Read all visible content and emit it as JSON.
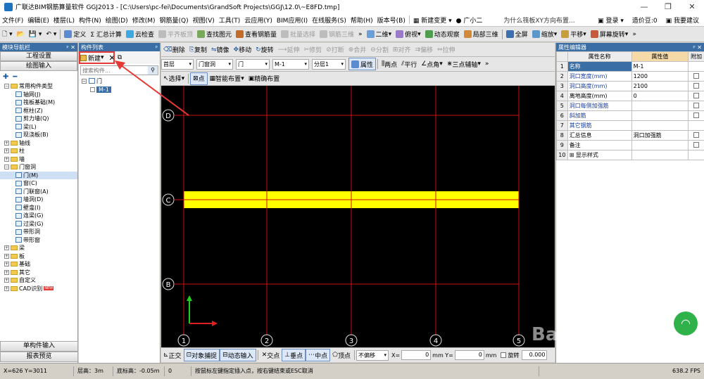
{
  "app": {
    "title": "广联达BIM钢筋算量软件 GGJ2013 - [C:\\Users\\pc-fei\\Documents\\GrandSoft Projects\\GGJ\\12.0\\~E8FD.tmp]",
    "window_controls": [
      "—",
      "❐",
      "✕"
    ]
  },
  "menu": {
    "items": [
      "文件(F)",
      "编辑(E)",
      "楼层(L)",
      "构件(N)",
      "绘图(D)",
      "修改(M)",
      "钢筋量(Q)",
      "视图(V)",
      "工具(T)",
      "云应用(Y)",
      "BIM应用(I)",
      "在线服务(S)",
      "帮助(H)",
      "版本号(B)"
    ],
    "new_change": "新建变更",
    "guang_xiao_er": "广小二",
    "tip": "为什么筏板XY方向布置...",
    "login": "登录",
    "zaojiadou": "造价豆:0",
    "suggest": "我要建议"
  },
  "toolbar1": {
    "items": [
      "定义",
      "Σ 汇总计算",
      "云检查",
      "平齐板顶",
      "查找图元",
      "查看钢筋量",
      "批量选择",
      "钢筋三维",
      "二维",
      "俯视",
      "动态观察",
      "局部三维",
      "全屏",
      "缩放",
      "平移",
      "屏幕旋转"
    ],
    "disabled": [
      3,
      6,
      7
    ]
  },
  "nav": {
    "header": "模块导航栏",
    "pin": "ᵖ ✕",
    "btn_project": "工程设置",
    "btn_draw": "绘图输入",
    "tree": [
      {
        "label": "常用构件类型",
        "level": 0,
        "type": "folder",
        "expanded": true
      },
      {
        "label": "轴网(J)",
        "level": 1,
        "type": "leaf"
      },
      {
        "label": "筏板基础(M)",
        "level": 1,
        "type": "leaf"
      },
      {
        "label": "框柱(Z)",
        "level": 1,
        "type": "leaf"
      },
      {
        "label": "剪力墙(Q)",
        "level": 1,
        "type": "leaf"
      },
      {
        "label": "梁(L)",
        "level": 1,
        "type": "leaf"
      },
      {
        "label": "现浇板(B)",
        "level": 1,
        "type": "leaf"
      },
      {
        "label": "轴线",
        "level": 0,
        "type": "folder",
        "expanded": false
      },
      {
        "label": "柱",
        "level": 0,
        "type": "folder",
        "expanded": false
      },
      {
        "label": "墙",
        "level": 0,
        "type": "folder",
        "expanded": false
      },
      {
        "label": "门窗洞",
        "level": 0,
        "type": "folder",
        "expanded": true
      },
      {
        "label": "门(M)",
        "level": 1,
        "type": "leaf",
        "selected": true
      },
      {
        "label": "窗(C)",
        "level": 1,
        "type": "leaf"
      },
      {
        "label": "门联窗(A)",
        "level": 1,
        "type": "leaf"
      },
      {
        "label": "墙洞(D)",
        "level": 1,
        "type": "leaf"
      },
      {
        "label": "壁龛(I)",
        "level": 1,
        "type": "leaf"
      },
      {
        "label": "连梁(G)",
        "level": 1,
        "type": "leaf"
      },
      {
        "label": "过梁(G)",
        "level": 1,
        "type": "leaf"
      },
      {
        "label": "带形洞",
        "level": 1,
        "type": "leaf"
      },
      {
        "label": "带形窗",
        "level": 1,
        "type": "leaf"
      },
      {
        "label": "梁",
        "level": 0,
        "type": "folder",
        "expanded": false
      },
      {
        "label": "板",
        "level": 0,
        "type": "folder",
        "expanded": false
      },
      {
        "label": "基础",
        "level": 0,
        "type": "folder",
        "expanded": false
      },
      {
        "label": "其它",
        "level": 0,
        "type": "folder",
        "expanded": false
      },
      {
        "label": "自定义",
        "level": 0,
        "type": "folder",
        "expanded": false
      },
      {
        "label": "CAD识别",
        "level": 0,
        "type": "folder",
        "expanded": false,
        "badge": "NEW"
      }
    ],
    "btn_single": "单构件输入",
    "btn_report": "报表预览"
  },
  "complist": {
    "header": "构件列表",
    "new_label": "新建",
    "search_placeholder": "搜索构件...",
    "tree_root": "门",
    "tree_item": "M-1"
  },
  "tb2": {
    "items": [
      "删除",
      "复制",
      "镜像",
      "移动",
      "旋转",
      "延伸",
      "修剪",
      "打断",
      "合并",
      "分割",
      "对齐",
      "偏移",
      "拉伸"
    ],
    "disabled": [
      5,
      6,
      7,
      8,
      9,
      10,
      11,
      12
    ]
  },
  "tb3": {
    "floor": "首层",
    "category": "门窗洞",
    "type": "门",
    "component": "M-1",
    "layer": "分层1",
    "props_btn": "属性",
    "two_point": "两点",
    "parallel": "平行",
    "point_angle": "点角",
    "three_point_axis": "三点辅轴"
  },
  "tb4": {
    "select": "选择",
    "point": "点",
    "smart": "智能布置",
    "precise": "精确布置"
  },
  "canvas": {
    "axis_rows": [
      "D",
      "C",
      "B"
    ],
    "axis_cols": [
      "1",
      "2",
      "3",
      "4",
      "5"
    ],
    "grid_color": "#cc1111",
    "wall_color": "#ffff00"
  },
  "snap": {
    "items": [
      "正交",
      "对象捕捉",
      "动态输入",
      "交点",
      "垂点",
      "中点",
      "顶点"
    ],
    "offset": "不偏移",
    "x_label": "X=",
    "x_val": "0",
    "x_unit": "mm Y=",
    "y_val": "0",
    "y_unit": "mm",
    "rot_label": "旋转",
    "rot_val": "0.000"
  },
  "props": {
    "header": "属性编辑器",
    "col_name": "属性名称",
    "col_value": "属性值",
    "col_extra": "附加",
    "rows": [
      {
        "n": "1",
        "name": "名称",
        "value": "M-1",
        "blue": true,
        "check": false,
        "selected": true
      },
      {
        "n": "2",
        "name": "洞口宽度(mm)",
        "value": "1200",
        "blue": true,
        "check": true
      },
      {
        "n": "3",
        "name": "洞口高度(mm)",
        "value": "2100",
        "blue": true,
        "check": true
      },
      {
        "n": "4",
        "name": "离地高度(mm)",
        "value": "0",
        "blue": false,
        "check": true
      },
      {
        "n": "5",
        "name": "洞口每侧加强筋",
        "value": "",
        "blue": true,
        "check": true
      },
      {
        "n": "6",
        "name": "斜加筋",
        "value": "",
        "blue": true,
        "check": true
      },
      {
        "n": "7",
        "name": "其它钢筋",
        "value": "",
        "blue": true,
        "check": false
      },
      {
        "n": "8",
        "name": "汇总信息",
        "value": "洞口加强筋",
        "blue": false,
        "check": true
      },
      {
        "n": "9",
        "name": "备注",
        "value": "",
        "blue": false,
        "check": true
      },
      {
        "n": "10",
        "name": "⊞ 显示样式",
        "value": "",
        "blue": false,
        "check": false
      }
    ]
  },
  "status": {
    "coords": "X=626 Y=3011",
    "floor_h": "层高：3m",
    "bottom_h": "底标高：-0.05m",
    "count": "0",
    "hint": "按鼠标左键指定插入点，按右键结束或ESC取消",
    "fps": "638.2 FPS"
  },
  "watermark": "Baidu经验"
}
